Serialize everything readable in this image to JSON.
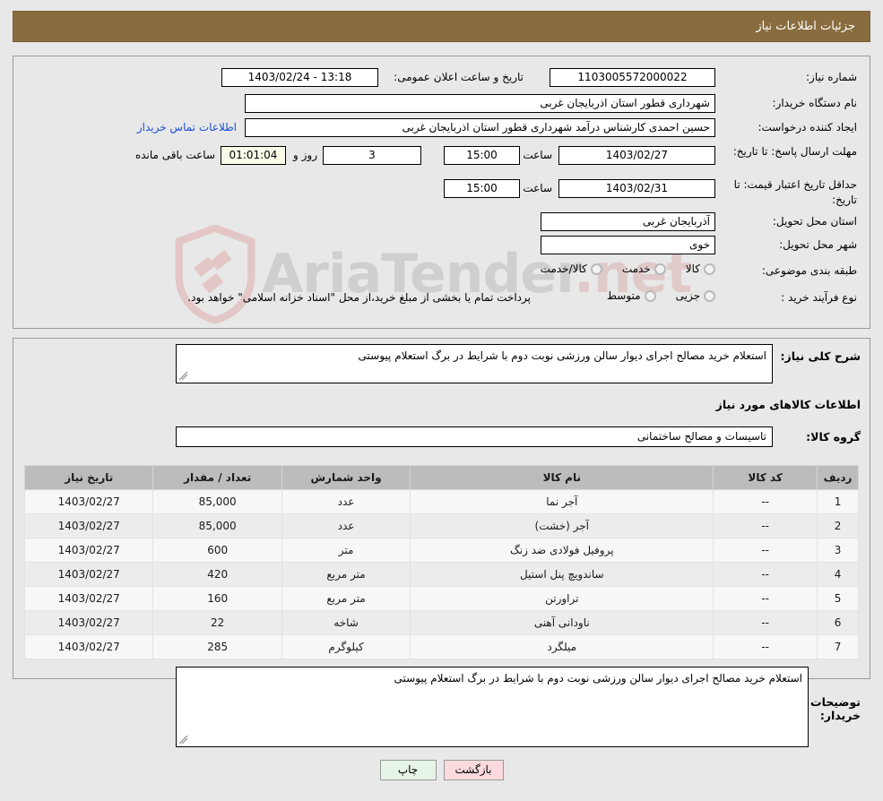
{
  "header": {
    "title": "جزئیات اطلاعات نیاز"
  },
  "colors": {
    "header_bar": "#8a6d3f",
    "header_text": "#ffffff",
    "page_bg": "#e8e8e8",
    "link": "#1a4fd6",
    "table_header": "#bcbcbc",
    "timer_bg": "#fbfbe8",
    "print_button": "#e6f5e6",
    "back_button": "#fadadd"
  },
  "watermark": {
    "text": "AriaTender",
    "suffix": ".net"
  },
  "top_form": {
    "need_number_label": "شماره نیاز:",
    "need_number_value": "1103005572000022",
    "announce_datetime_label": "تاریخ و ساعت اعلان عمومی:",
    "announce_datetime_value": "13:18 - 1403/02/24",
    "buyer_org_label": "نام دستگاه خریدار:",
    "buyer_org_value": "شهرداری قطور استان اذربایجان غربی",
    "creator_label": "ایجاد کننده درخواست:",
    "creator_value": "حسین احمدی کارشناس درآمد شهرداری قطور استان اذربایجان غربی",
    "contact_link": "اطلاعات تماس خریدار",
    "response_deadline_label": "مهلت ارسال پاسخ: تا تاریخ:",
    "response_deadline_date": "1403/02/27",
    "hour_label": "ساعت",
    "response_deadline_time": "15:00",
    "remaining_days": "3",
    "remaining_days_label": "روز و",
    "remaining_timer": "01:01:04",
    "remaining_suffix": "ساعت باقی مانده",
    "price_validity_label": "حداقل تاریخ اعتبار قیمت: تا تاریخ:",
    "price_validity_date": "1403/02/31",
    "price_validity_time": "15:00",
    "delivery_province_label": "استان محل تحویل:",
    "delivery_province_value": "آذربایجان غربی",
    "delivery_city_label": "شهر محل تحویل:",
    "delivery_city_value": "خوی",
    "category_label": "طبقه بندی موضوعی:",
    "category_options": [
      "کالا",
      "خدمت",
      "کالا/خدمت"
    ],
    "process_type_label": "نوع فرآیند خرید :",
    "process_type_options": [
      "جزیی",
      "متوسط"
    ],
    "process_note": "پرداخت تمام یا بخشی از مبلغ خرید،از محل \"اسناد خزانه اسلامی\" خواهد بود."
  },
  "middle": {
    "need_summary_label": "شرح کلی نیاز:",
    "need_summary_value": "استعلام خرید مصالح اجرای دیوار سالن ورزشی نوبت دوم با شرایط در برگ استعلام پیوستی",
    "items_section_title": "اطلاعات کالاهای مورد نیاز",
    "goods_group_label": "گروه کالا:",
    "goods_group_value": "تاسیسات و مصالح ساختمانی",
    "buyer_notes_label": "توضیحات خریدار:",
    "buyer_notes_value": "استعلام خرید مصالح اجرای دیوار سالن ورزشی نوبت دوم با شرایط در برگ استعلام پیوستی"
  },
  "table": {
    "columns": [
      "ردیف",
      "کد کالا",
      "نام کالا",
      "واحد شمارش",
      "تعداد / مقدار",
      "تاریخ نیاز"
    ],
    "rows": [
      {
        "row": "1",
        "code": "--",
        "name": "آجر نما",
        "unit": "عدد",
        "qty": "85,000",
        "date": "1403/02/27"
      },
      {
        "row": "2",
        "code": "--",
        "name": "آجر (خشت)",
        "unit": "عدد",
        "qty": "85,000",
        "date": "1403/02/27"
      },
      {
        "row": "3",
        "code": "--",
        "name": "پروفیل فولادی ضد زنگ",
        "unit": "متر",
        "qty": "600",
        "date": "1403/02/27"
      },
      {
        "row": "4",
        "code": "--",
        "name": "ساندویچ پنل استیل",
        "unit": "متر مربع",
        "qty": "420",
        "date": "1403/02/27"
      },
      {
        "row": "5",
        "code": "--",
        "name": "تراورتن",
        "unit": "متر مربع",
        "qty": "160",
        "date": "1403/02/27"
      },
      {
        "row": "6",
        "code": "--",
        "name": "ناودانی آهنی",
        "unit": "شاخه",
        "qty": "22",
        "date": "1403/02/27"
      },
      {
        "row": "7",
        "code": "--",
        "name": "میلگرد",
        "unit": "کیلوگرم",
        "qty": "285",
        "date": "1403/02/27"
      }
    ]
  },
  "footer": {
    "print_label": "چاپ",
    "back_label": "بازگشت"
  }
}
